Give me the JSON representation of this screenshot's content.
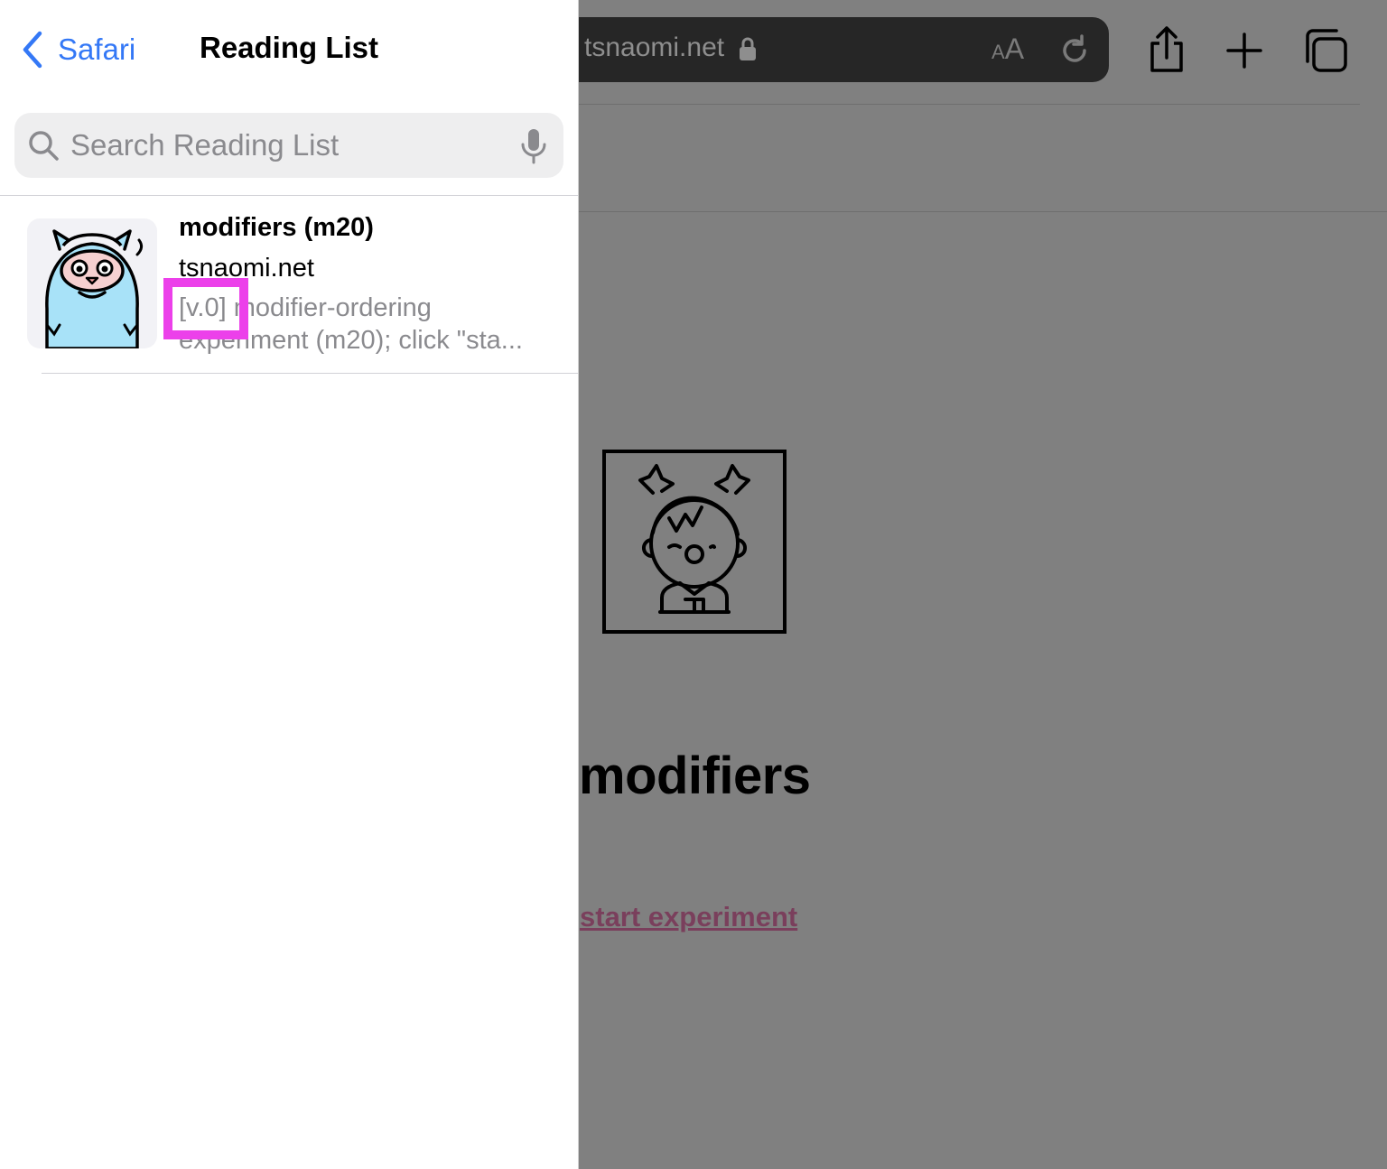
{
  "browser": {
    "url_text": "tsnaomi.net",
    "text_size_label_small": "A",
    "text_size_label_large": "A"
  },
  "webpage": {
    "heading": "modifiers",
    "start_link": "start experiment"
  },
  "reading_list": {
    "back_label": "Safari",
    "title": "Reading List",
    "search_placeholder": "Search Reading List",
    "items": [
      {
        "title": "modifiers (m20)",
        "domain": "tsnaomi.net",
        "description_line1": "[v.0] modifier-ordering",
        "description_line2": "experiment (m20); click \"sta..."
      }
    ]
  },
  "colors": {
    "accent": "#3478f6",
    "highlight": "#ec40ea",
    "dim_overlay": "#808080"
  }
}
